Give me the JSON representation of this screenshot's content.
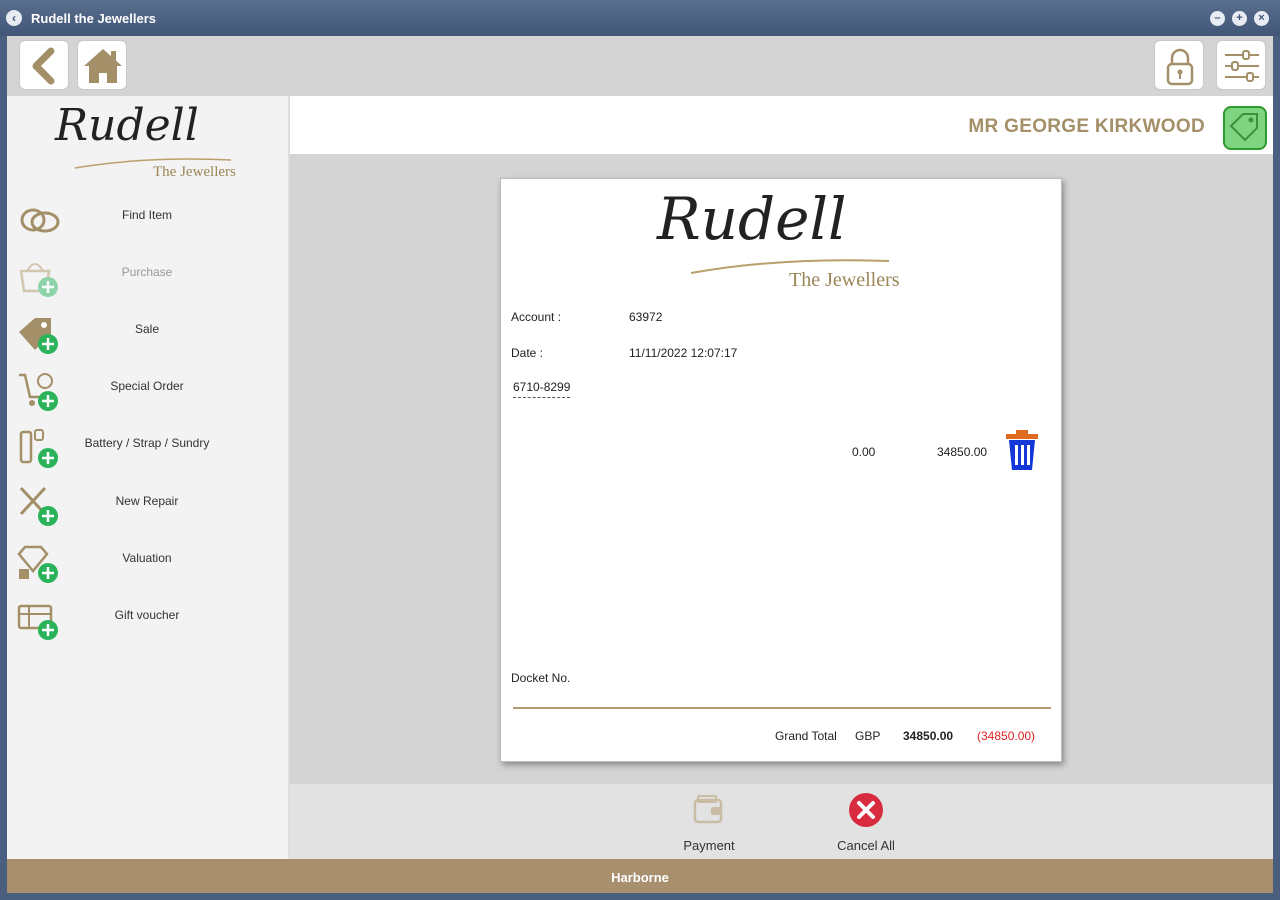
{
  "window": {
    "title": "Rudell the Jewellers",
    "controls": [
      "minimize-icon",
      "maximize-icon",
      "close-icon"
    ]
  },
  "toolbar": {
    "left": [
      "back-arrow-icon",
      "home-icon"
    ],
    "right": [
      "padlock-icon",
      "settings-sliders-icon"
    ]
  },
  "brand": {
    "script": "Rudell",
    "sub": "The Jewellers",
    "accent_color": "#a88f6d"
  },
  "sidebar": {
    "items": [
      {
        "label": "Find Item",
        "icon": "rings-icon",
        "enabled": true
      },
      {
        "label": "Purchase",
        "icon": "basket-add-icon",
        "enabled": false
      },
      {
        "label": "Sale",
        "icon": "price-tag-add-icon",
        "enabled": true
      },
      {
        "label": "Special Order",
        "icon": "cart-add-icon",
        "enabled": true
      },
      {
        "label": "Battery / Strap / Sundry",
        "icon": "battery-add-icon",
        "enabled": true
      },
      {
        "label": "New Repair",
        "icon": "tools-add-icon",
        "enabled": true
      },
      {
        "label": "Valuation",
        "icon": "diamond-add-icon",
        "enabled": true
      },
      {
        "label": "Gift voucher",
        "icon": "gift-add-icon",
        "enabled": true
      }
    ]
  },
  "customer": {
    "name": "MR GEORGE  KIRKWOOD",
    "tag_icon": "customer-tag-icon"
  },
  "receipt": {
    "account_label": "Account :",
    "account_value": "63972",
    "date_label": "Date :",
    "date_value": "11/11/2022 12:07:17",
    "item_code": "6710-8299",
    "line_discount": "0.00",
    "line_amount": "34850.00",
    "docket_label": "Docket No.",
    "grand_total_label": "Grand Total",
    "currency": "GBP",
    "grand_total": "34850.00",
    "balance_due": "(34850.00)",
    "balance_color": "#e02020"
  },
  "actions": {
    "payment_label": "Payment",
    "cancel_label": "Cancel All"
  },
  "status": {
    "branch": "Harborne"
  }
}
